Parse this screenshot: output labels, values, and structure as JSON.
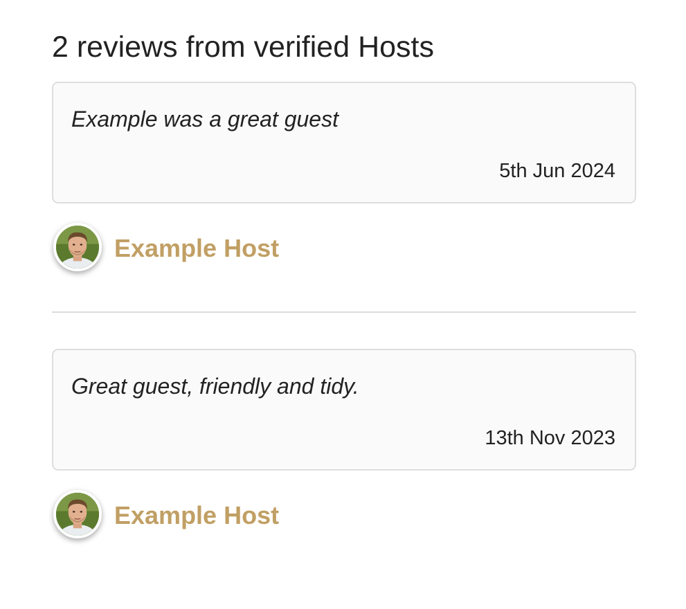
{
  "reviews_section": {
    "heading": "2 reviews from verified Hosts",
    "reviews": [
      {
        "text": "Example was a great guest",
        "date": "5th Jun 2024",
        "author": "Example Host",
        "avatar_icon": "host-avatar-photo"
      },
      {
        "text": "Great guest, friendly and tidy.",
        "date": "13th Nov 2023",
        "author": "Example Host",
        "avatar_icon": "host-avatar-photo"
      }
    ]
  },
  "colors": {
    "author_link": "#c19f64",
    "card_background": "#fafafa",
    "card_border": "#dedede",
    "text": "#222222"
  }
}
